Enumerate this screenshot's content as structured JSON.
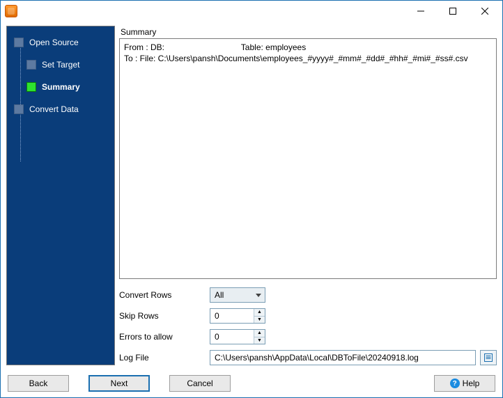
{
  "titlebar": {
    "title": ""
  },
  "sidebar": {
    "steps": [
      {
        "label": "Open Source",
        "active": false
      },
      {
        "label": "Set Target",
        "active": false
      },
      {
        "label": "Summary",
        "active": true
      },
      {
        "label": "Convert Data",
        "active": false
      }
    ]
  },
  "summary": {
    "heading": "Summary",
    "line1": "From : DB:                                 Table: employees",
    "line2": "To : File: C:\\Users\\pansh\\Documents\\employees_#yyyy#_#mm#_#dd#_#hh#_#mi#_#ss#.csv"
  },
  "form": {
    "convert_rows_label": "Convert Rows",
    "convert_rows_value": "All",
    "skip_rows_label": "Skip Rows",
    "skip_rows_value": "0",
    "errors_label": "Errors to allow",
    "errors_value": "0",
    "logfile_label": "Log File",
    "logfile_value": "C:\\Users\\pansh\\AppData\\Local\\DBToFile\\20240918.log"
  },
  "buttons": {
    "back": "Back",
    "next": "Next",
    "cancel": "Cancel",
    "help": "Help"
  }
}
